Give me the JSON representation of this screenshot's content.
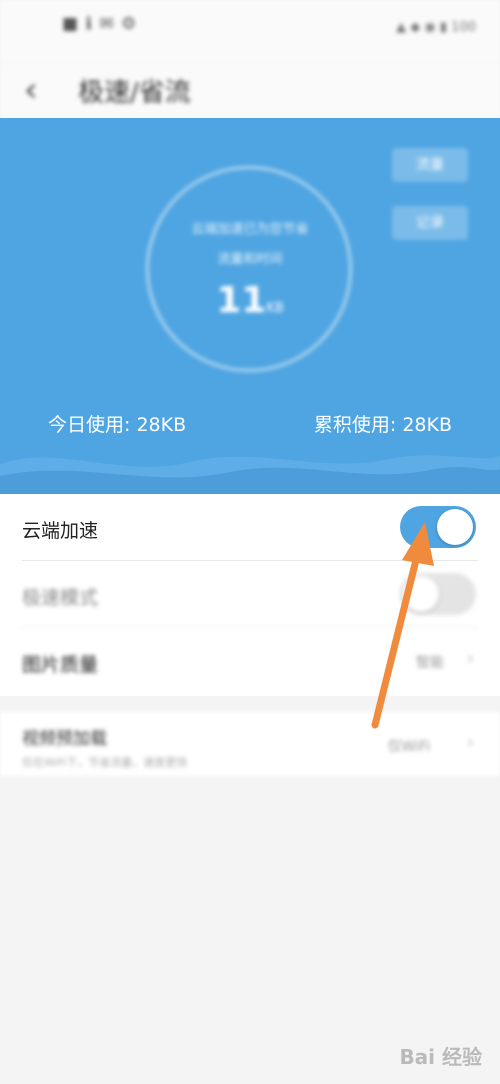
{
  "status_bar": {
    "left_text": "■ ℹ ✉ ⚙",
    "right_text": "▲ ◆ ◉ ▮ 100"
  },
  "header": {
    "back_icon": "back-arrow-icon",
    "title": "极速/省流"
  },
  "hero": {
    "button1": "流量",
    "button2": "记录",
    "ring_line1": "云端加速已为您节省",
    "ring_line2": "流量和时间",
    "ring_value": "11",
    "ring_unit": "KB",
    "today_usage": "今日使用: 28KB",
    "total_usage": "累积使用: 28KB",
    "background_color": "#4fa5e2"
  },
  "settings": {
    "cloud_accel": {
      "label": "云端加速",
      "enabled": true
    },
    "speed_mode": {
      "label": "极速模式",
      "enabled": false
    },
    "image_quality": {
      "label": "图片质量",
      "value": "智能"
    },
    "video_accel": {
      "label": "视频预加载",
      "sub": "仅在WiFi下，节省流量，速度更快",
      "value": "仅WiFi"
    }
  },
  "watermark": "Bai 经验",
  "accent_colors": {
    "toggle_on": "#4fa5e2",
    "annotation_arrow": "#f08a3c"
  }
}
